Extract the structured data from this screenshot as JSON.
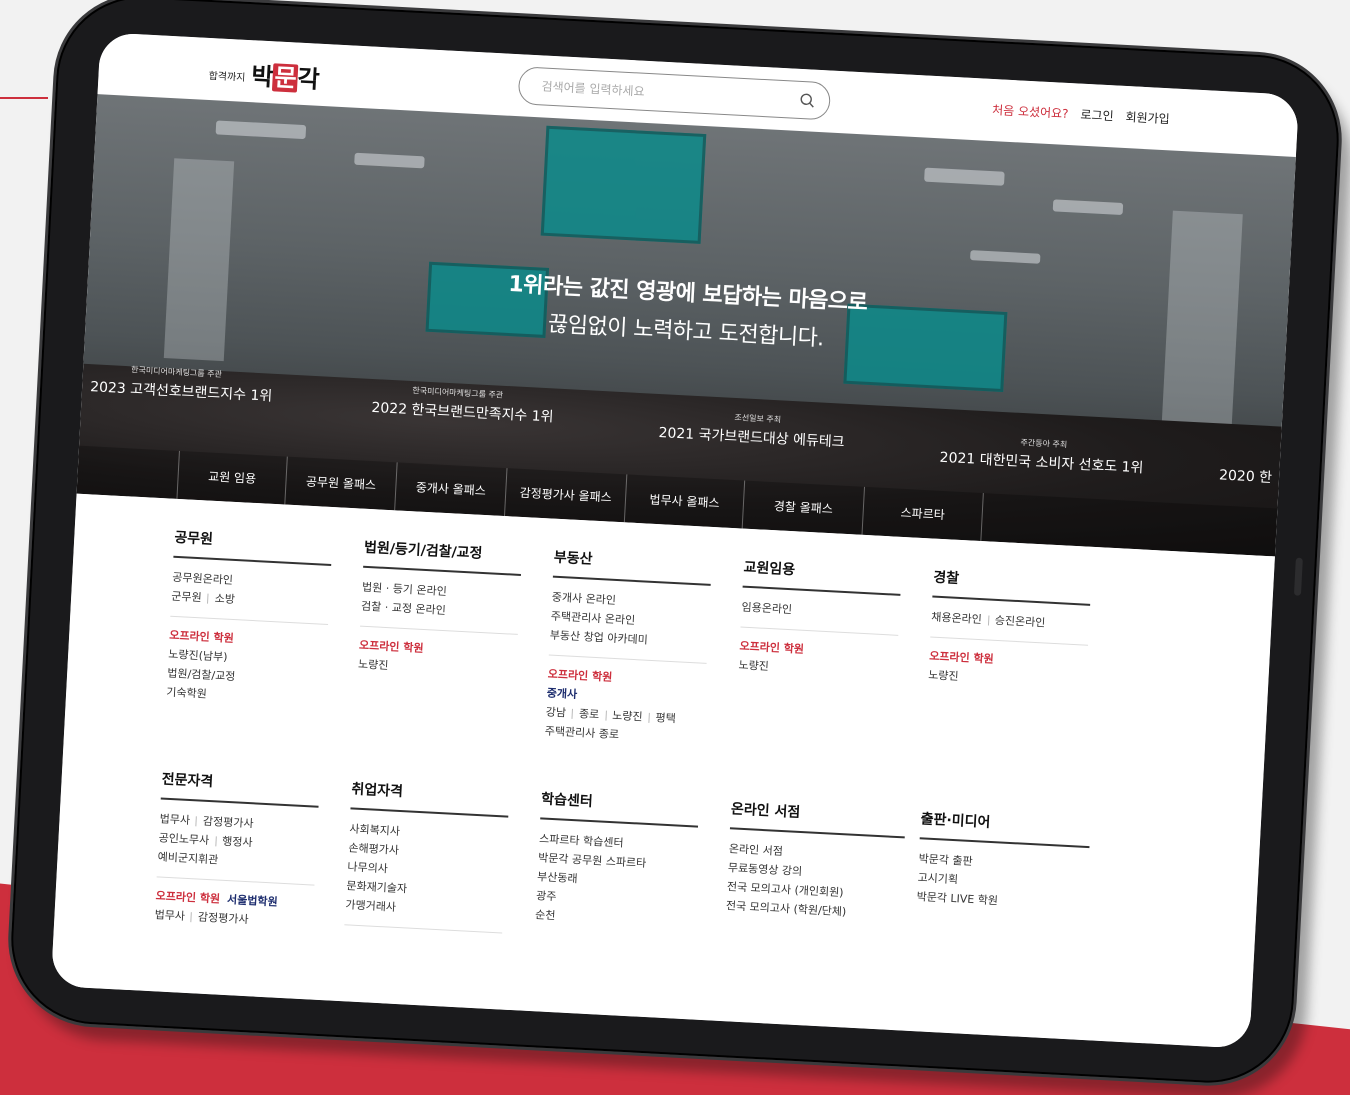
{
  "header": {
    "slogan": "합격까지",
    "brand_left": "박",
    "brand_mid": "문",
    "brand_right": "각",
    "search_placeholder": "검색어를 입력하세요",
    "links": [
      "처음 오셨어요?",
      "로그인",
      "회원가입"
    ]
  },
  "hero": {
    "headline": "1위라는 값진 영광에 보답하는 마음으로",
    "subline": "끊임없이 노력하고 도전합니다.",
    "awards": [
      {
        "sub": "한국미디어마케팅그룹 주관",
        "main": "2023 고객선호브랜드지수 1위"
      },
      {
        "sub": "한국미디어마케팅그룹 주관",
        "main": "2022 한국브랜드만족지수 1위"
      },
      {
        "sub": "조선일보 주최",
        "main": "2021 국가브랜드대상 에듀테크"
      },
      {
        "sub": "주간동아 주최",
        "main": "2021 대한민국 소비자 선호도 1위"
      },
      {
        "sub": "",
        "main": "2020 한"
      }
    ]
  },
  "gnb": [
    "교원 임용",
    "공무원 올패스",
    "중개사 올패스",
    "감정평가사 올패스",
    "법무사 올패스",
    "경찰 올패스",
    "스파르타"
  ],
  "categories": {
    "gongmuwon": {
      "title": "공무원",
      "l1": "공무원온라인",
      "l2a": "군무원",
      "l2b": "소방",
      "offline": "오프라인 학원",
      "o1": "노량진(남부)",
      "o2": "법원/검찰/교정",
      "o3": "기숙학원"
    },
    "court": {
      "title": "법원/등기/검찰/교정",
      "l1": "법원 · 등기 온라인",
      "l2": "검찰 · 교정 온라인",
      "offline": "오프라인 학원",
      "o1": "노량진"
    },
    "realestate": {
      "title": "부동산",
      "l1": "중개사 온라인",
      "l2": "주택관리사 온라인",
      "l3": "부동산 창업 아카데미",
      "offline": "오프라인 학원",
      "sub": "중개사",
      "o1": "강남",
      "o2": "종로",
      "o3": "노량진",
      "o4": "평택",
      "o5": "주택관리사 종로"
    },
    "teacher": {
      "title": "교원임용",
      "l1": "임용온라인",
      "offline": "오프라인 학원",
      "o1": "노량진"
    },
    "police": {
      "title": "경찰",
      "l1a": "채용온라인",
      "l1b": "승진온라인",
      "offline": "오프라인 학원",
      "o1": "노량진"
    },
    "pro": {
      "title": "전문자격",
      "l1a": "법무사",
      "l1b": "감정평가사",
      "l2a": "공인노무사",
      "l2b": "행정사",
      "l3": "예비군지휘관",
      "offline": "오프라인 학원",
      "seoul": "서울법학원",
      "o1a": "법무사",
      "o1b": "감정평가사"
    },
    "job": {
      "title": "취업자격",
      "l1": "사회복지사",
      "l2": "손해평가사",
      "l3": "나무의사",
      "l4": "문화재기술자",
      "l5": "가맹거래사"
    },
    "study": {
      "title": "학습센터",
      "l1": "스파르타 학습센터",
      "l2": "박문각 공무원 스파르타",
      "l3": "부산동래",
      "l4": "광주",
      "l5": "순천"
    },
    "books": {
      "title": "온라인 서점",
      "l1": "온라인 서점",
      "l2": "무료동영상 강의",
      "l3": "전국 모의고사 (개인회원)",
      "l4": "전국 모의고사 (학원/단체)"
    },
    "media": {
      "title": "출판·미디어",
      "l1": "박문각 출판",
      "l2": "고시기획",
      "l3": "박문각 LIVE 학원"
    }
  },
  "colors": {
    "accent": "#cd2f3d",
    "navy": "#1d2d6e"
  }
}
